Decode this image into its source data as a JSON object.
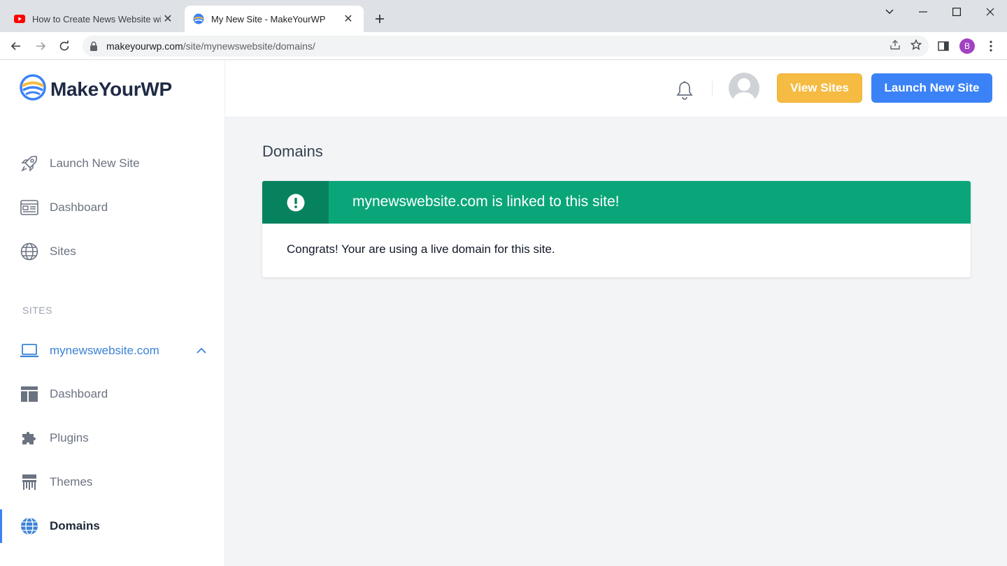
{
  "browser": {
    "tabs": [
      {
        "title": "How to Create News Website wit",
        "favicon": "youtube-icon",
        "active": false
      },
      {
        "title": "My New Site - MakeYourWP",
        "favicon": "makeyourwp-icon",
        "active": true
      }
    ],
    "url_host": "makeyourwp.com",
    "url_path": "/site/mynewswebsite/domains/",
    "profile_initial": "B"
  },
  "sidebar": {
    "logo_text": "MakeYourWP",
    "main_items": [
      {
        "label": "Launch New Site",
        "icon": "rocket-icon"
      },
      {
        "label": "Dashboard",
        "icon": "dashboard-icon"
      },
      {
        "label": "Sites",
        "icon": "globe-icon"
      }
    ],
    "section_label": "SITES",
    "site": {
      "label": "mynewswebsite.com",
      "icon": "laptop-icon",
      "expanded": true
    },
    "site_items": [
      {
        "label": "Dashboard",
        "icon": "layout-icon"
      },
      {
        "label": "Plugins",
        "icon": "puzzle-icon"
      },
      {
        "label": "Themes",
        "icon": "paintbrush-icon"
      },
      {
        "label": "Domains",
        "icon": "globe-icon",
        "active": true
      }
    ]
  },
  "header": {
    "view_sites_label": "View Sites",
    "launch_label": "Launch New Site"
  },
  "main": {
    "title": "Domains",
    "alert": {
      "message": "mynewswebsite.com is linked to this site!",
      "body": "Congrats! Your are using a live domain for this site."
    }
  },
  "colors": {
    "accent_blue": "#3b82f6",
    "view_sites_yellow": "#f6bb42",
    "success_green": "#0aa67a",
    "success_green_dark": "#07825f"
  }
}
